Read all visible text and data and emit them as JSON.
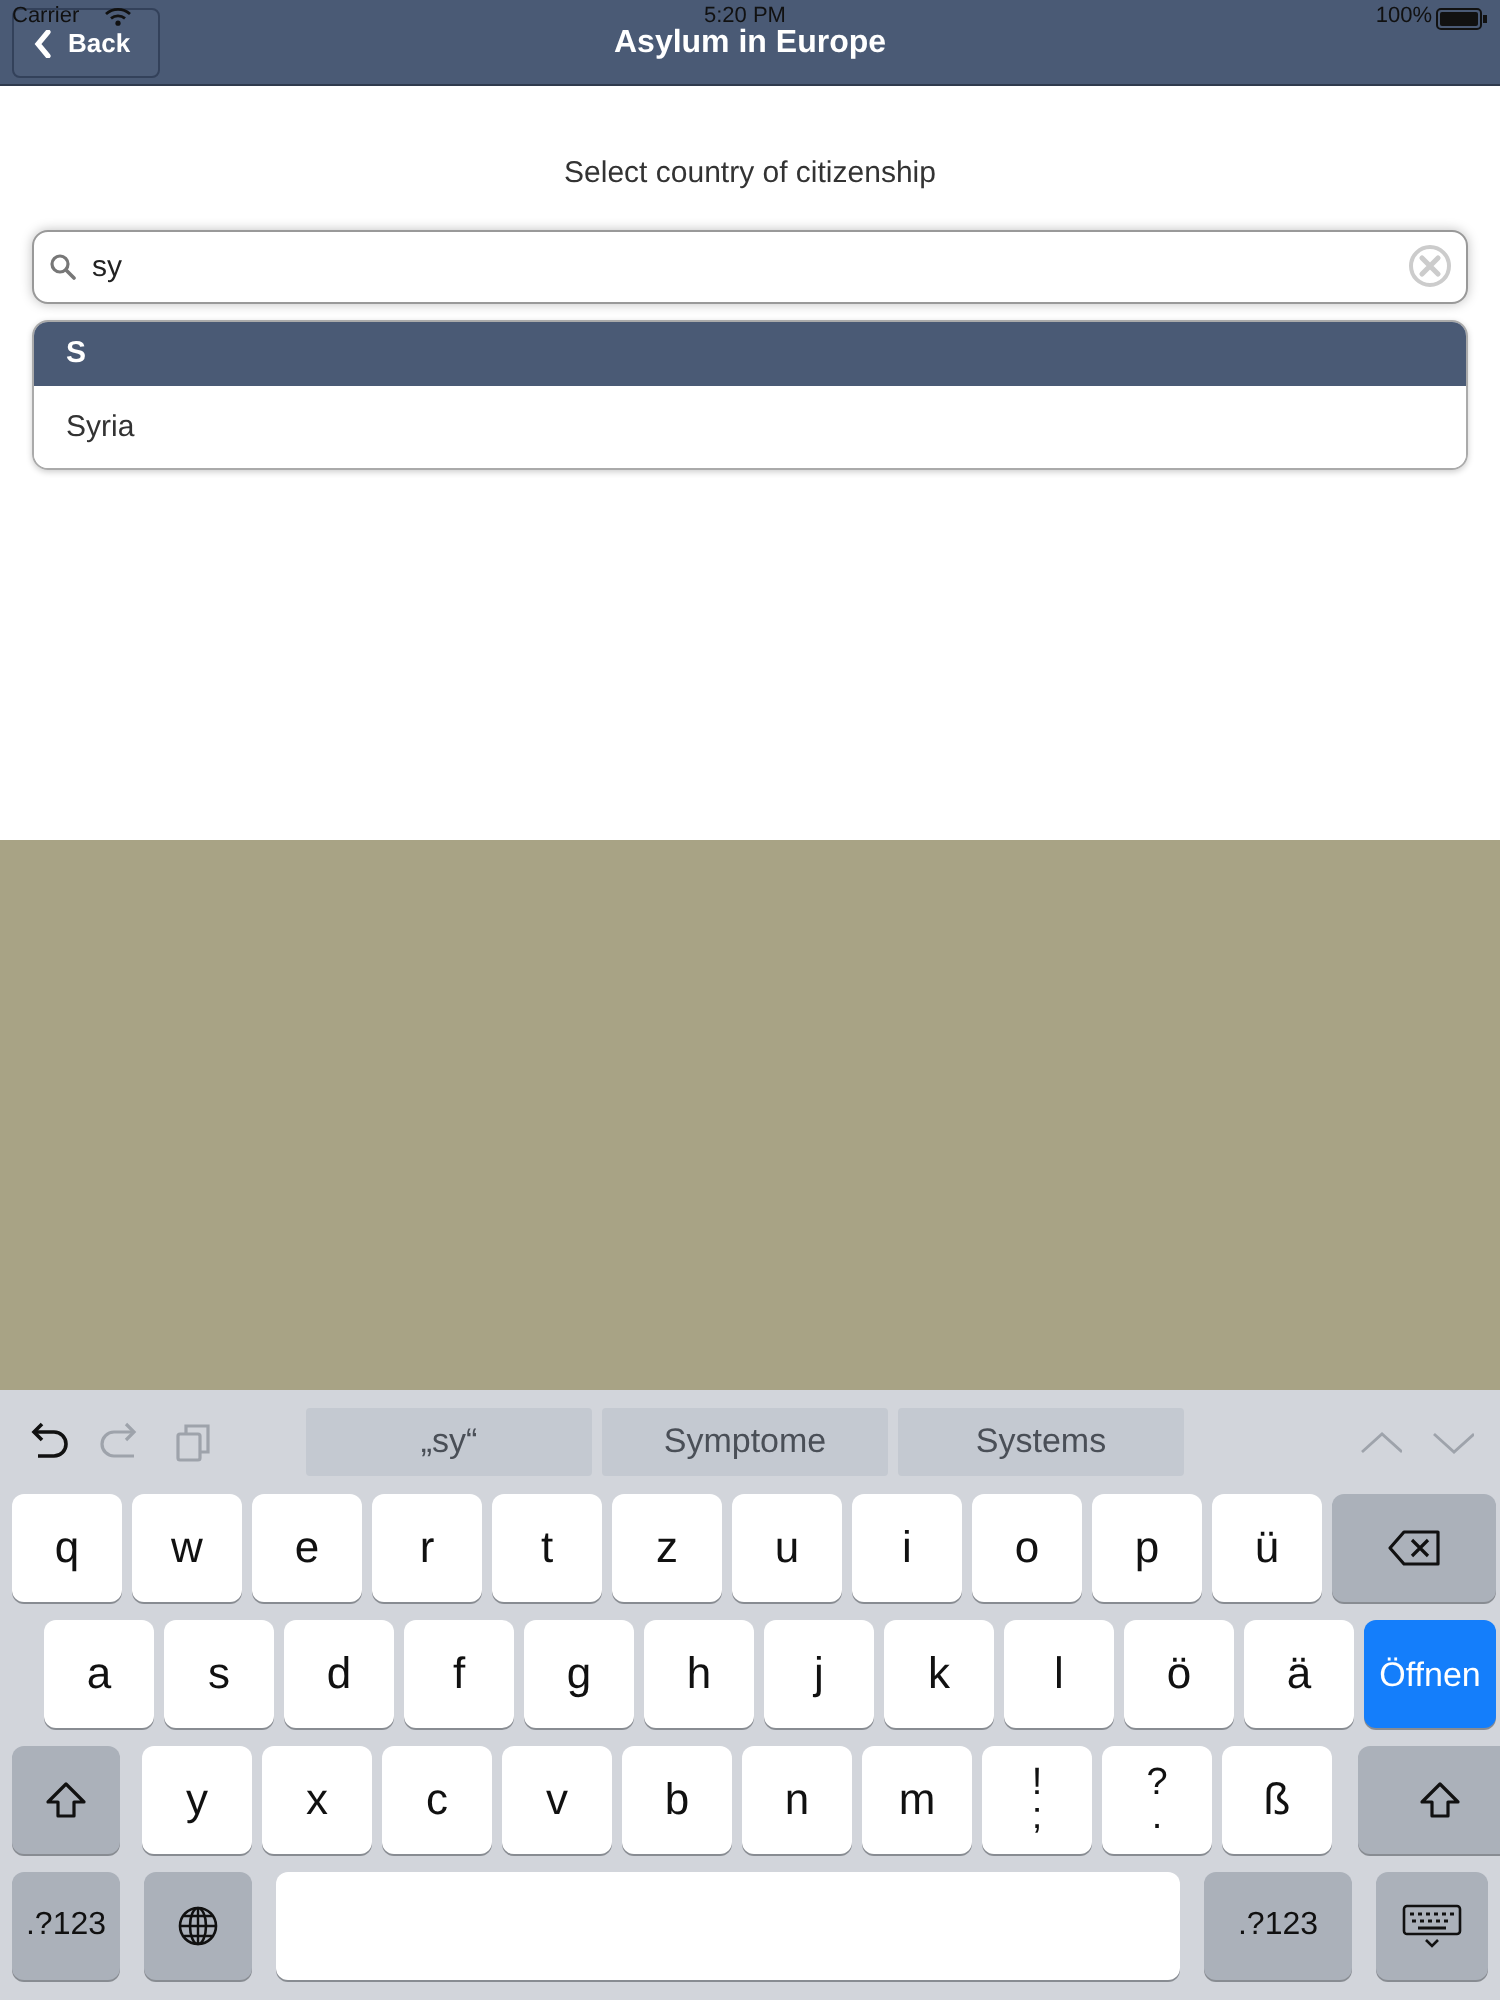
{
  "status_bar": {
    "carrier": "Carrier",
    "time": "5:20 PM",
    "battery": "100%"
  },
  "nav_bar": {
    "back": "Back",
    "title": "Asylum in Europe"
  },
  "prompt": "Select country of citizenship",
  "search": {
    "value": "sy"
  },
  "results": [
    {
      "header": "S",
      "items": [
        "Syria"
      ]
    }
  ],
  "keyboard": {
    "tools": [
      {
        "kind": "undo",
        "disabled": false
      },
      {
        "kind": "redo",
        "disabled": true
      },
      {
        "kind": "paste",
        "disabled": true
      }
    ],
    "suggestions": [
      "„sy“",
      "Symptome",
      "Systems"
    ],
    "arrows": [
      {
        "kind": "up",
        "disabled": true
      },
      {
        "kind": "down",
        "disabled": true
      }
    ],
    "rows": [
      {
        "keys": [
          {
            "kind": "char",
            "label": "q"
          },
          {
            "kind": "char",
            "label": "w"
          },
          {
            "kind": "char",
            "label": "e"
          },
          {
            "kind": "char",
            "label": "r"
          },
          {
            "kind": "char",
            "label": "t"
          },
          {
            "kind": "char",
            "label": "z"
          },
          {
            "kind": "char",
            "label": "u"
          },
          {
            "kind": "char",
            "label": "i"
          },
          {
            "kind": "char",
            "label": "o"
          },
          {
            "kind": "char",
            "label": "p"
          },
          {
            "kind": "char",
            "label": "ü"
          },
          {
            "kind": "backspace"
          }
        ]
      },
      {
        "keys": [
          {
            "kind": "char",
            "label": "a"
          },
          {
            "kind": "char",
            "label": "s"
          },
          {
            "kind": "char",
            "label": "d"
          },
          {
            "kind": "char",
            "label": "f"
          },
          {
            "kind": "char",
            "label": "g"
          },
          {
            "kind": "char",
            "label": "h"
          },
          {
            "kind": "char",
            "label": "j"
          },
          {
            "kind": "char",
            "label": "k"
          },
          {
            "kind": "char",
            "label": "l"
          },
          {
            "kind": "char",
            "label": "ö"
          },
          {
            "kind": "char",
            "label": "ä"
          },
          {
            "kind": "return",
            "label": "Öffnen"
          }
        ]
      },
      {
        "keys": [
          {
            "kind": "shift"
          },
          {
            "kind": "char",
            "label": "y"
          },
          {
            "kind": "char",
            "label": "x"
          },
          {
            "kind": "char",
            "label": "c"
          },
          {
            "kind": "char",
            "label": "v"
          },
          {
            "kind": "char",
            "label": "b"
          },
          {
            "kind": "char",
            "label": "n"
          },
          {
            "kind": "char",
            "label": "m"
          },
          {
            "kind": "dual",
            "top": "!",
            "bottom": ";"
          },
          {
            "kind": "dual",
            "top": "?",
            "bottom": "."
          },
          {
            "kind": "char",
            "label": "ß"
          },
          {
            "kind": "shift"
          }
        ]
      },
      {
        "keys": [
          {
            "kind": "mode",
            "label": ".?123"
          },
          {
            "kind": "globe"
          },
          {
            "kind": "space"
          },
          {
            "kind": "mode",
            "label": ".?123"
          },
          {
            "kind": "hide"
          }
        ]
      }
    ]
  }
}
